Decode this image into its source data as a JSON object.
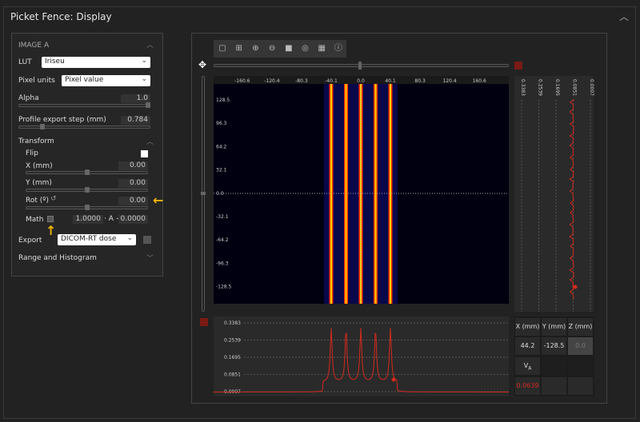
{
  "window": {
    "title": "Picket Fence: Display"
  },
  "panel": {
    "header": "IMAGE A",
    "lut": {
      "label": "LUT",
      "value": "Iriseu"
    },
    "pixel_units": {
      "label": "Pixel units",
      "value": "Pixel value"
    },
    "alpha": {
      "label": "Alpha",
      "value": "1.0",
      "level": 1.0
    },
    "profile_step": {
      "label": "Profile export step (mm)",
      "value": "0.784"
    },
    "transform": {
      "label": "Transform",
      "flip": "Flip",
      "x": {
        "label": "X (mm)",
        "value": "0.00"
      },
      "y": {
        "label": "Y (mm)",
        "value": "0.00"
      },
      "rot": {
        "label": "Rot (º)",
        "value": "0.00"
      },
      "math": {
        "label": "Math",
        "scale": "1.0000",
        "op": "· A +",
        "offset": "0.0000"
      }
    },
    "export": {
      "label": "Export",
      "value": "DICOM-RT dose"
    },
    "range": "Range and Histogram"
  },
  "viewer": {
    "toolbar": [
      "square-icon",
      "zoom-fit-icon",
      "zoom-in-icon",
      "zoom-out-icon",
      "fill-icon",
      "target-icon",
      "grid-icon",
      "info-icon"
    ],
    "x_ticks": [
      "-160.6",
      "-120.4",
      "-80.3",
      "-40.1",
      "0.0",
      "40.1",
      "80.3",
      "120.4",
      "160.6"
    ],
    "y_ticks": [
      "128.5",
      "96.3",
      "64.2",
      "32.1",
      "0.0",
      "-32.1",
      "-64.2",
      "-96.3",
      "-128.5"
    ],
    "profile_ticks": [
      "0.3383",
      "0.2539",
      "0.1695",
      "0.0851",
      "0.0007"
    ],
    "leaf_positions_mm": [
      -40.1,
      -20,
      0,
      20,
      40.1
    ],
    "table": {
      "headers": [
        "X (mm)",
        "Y (mm)",
        "Z (mm)"
      ],
      "values": [
        "44.2",
        "-128.5",
        "0.0"
      ],
      "value_label": "V",
      "value_sub": "A",
      "value": "0.0639"
    },
    "accent": "#d42a1e"
  }
}
